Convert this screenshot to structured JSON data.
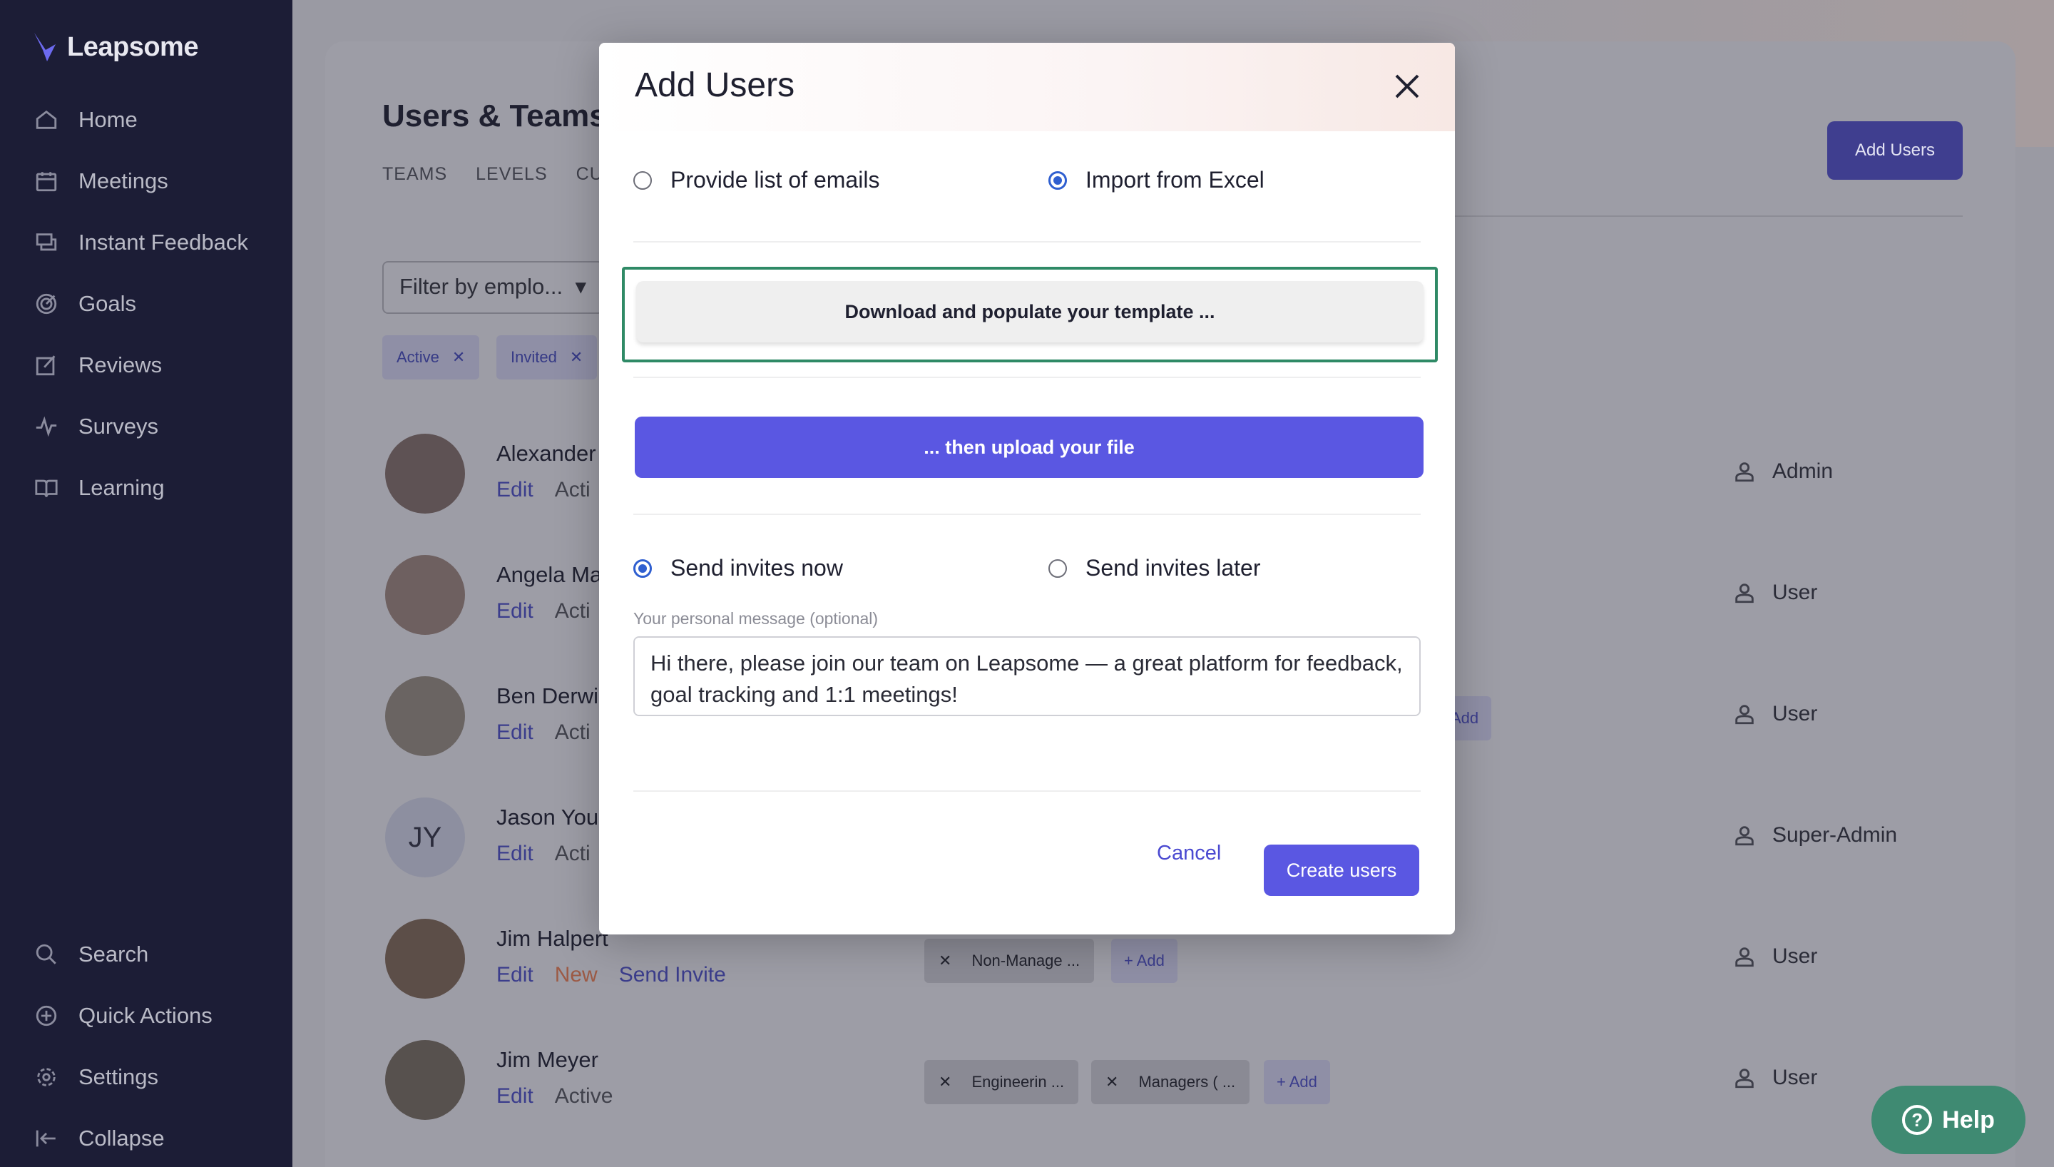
{
  "brand": {
    "name": "Leapsome"
  },
  "sidebar": {
    "items": [
      {
        "label": "Home",
        "icon": "home-icon"
      },
      {
        "label": "Meetings",
        "icon": "calendar-icon"
      },
      {
        "label": "Instant Feedback",
        "icon": "chat-icon"
      },
      {
        "label": "Goals",
        "icon": "target-icon"
      },
      {
        "label": "Reviews",
        "icon": "edit-icon"
      },
      {
        "label": "Surveys",
        "icon": "pulse-icon"
      },
      {
        "label": "Learning",
        "icon": "book-icon"
      }
    ],
    "bottom": [
      {
        "label": "Search",
        "icon": "search-icon"
      },
      {
        "label": "Quick Actions",
        "icon": "plus-circle-icon"
      },
      {
        "label": "Settings",
        "icon": "gear-icon"
      },
      {
        "label": "Collapse",
        "icon": "collapse-icon"
      }
    ]
  },
  "page": {
    "title": "Users & Teams",
    "tabs": [
      "TEAMS",
      "LEVELS",
      "CUS"
    ],
    "add_users_label": "Add Users",
    "filter_placeholder": "Filter by emplo...",
    "chips": [
      "Active",
      "Invited"
    ]
  },
  "users": [
    {
      "name": "Alexander",
      "edit": "Edit",
      "status": "Acti",
      "role": "Admin"
    },
    {
      "name": "Angela Ma",
      "edit": "Edit",
      "status": "Acti",
      "role": "User"
    },
    {
      "name": "Ben Derwi",
      "edit": "Edit",
      "status": "Acti",
      "role": "User",
      "add": "Add"
    },
    {
      "name": "Jason You",
      "initials": "JY",
      "edit": "Edit",
      "status": "Acti",
      "role": "Super-Admin"
    },
    {
      "name": "Jim Halpert",
      "edit": "Edit",
      "status": "New",
      "invite": "Send Invite",
      "role": "User",
      "teams": [
        "Non-Manage ..."
      ],
      "add": "+ Add"
    },
    {
      "name": "Jim Meyer",
      "edit": "Edit",
      "status": "Active",
      "role": "User",
      "teams": [
        "Engineerin ...",
        "Managers ( ..."
      ],
      "add": "+ Add"
    }
  ],
  "help": {
    "label": "Help"
  },
  "modal": {
    "title": "Add Users",
    "source_options": [
      {
        "label": "Provide list of emails",
        "checked": false
      },
      {
        "label": "Import from Excel",
        "checked": true
      }
    ],
    "download_label": "Download and populate your template ...",
    "upload_label": "... then upload your file",
    "invite_options": [
      {
        "label": "Send invites now",
        "checked": true
      },
      {
        "label": "Send invites later",
        "checked": false
      }
    ],
    "message_label": "Your personal message (optional)",
    "message_value": "Hi there, please join our team on Leapsome — a great platform for feedback, goal tracking and 1:1 meetings!",
    "cancel_label": "Cancel",
    "create_label": "Create users"
  },
  "colors": {
    "sidebar_bg": "#1c1d36",
    "accent": "#5a57e2",
    "focus_outline": "#2f8a66",
    "help_bg": "#3f8a72"
  }
}
